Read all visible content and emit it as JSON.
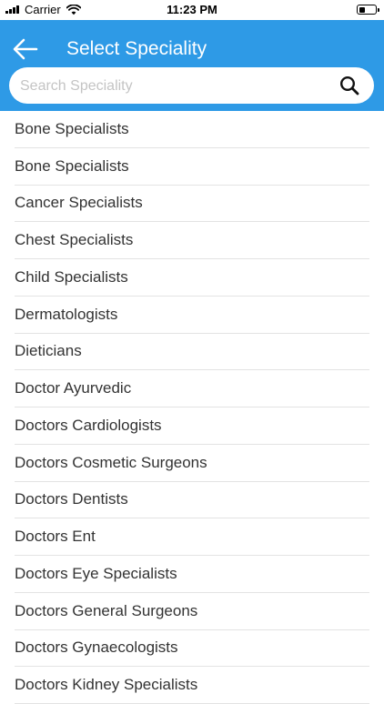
{
  "status_bar": {
    "carrier": "Carrier",
    "time": "11:23 PM"
  },
  "header": {
    "title": "Select Speciality",
    "back_icon": "arrow-left-icon",
    "background": "#2e9ae6"
  },
  "search": {
    "placeholder": "Search Speciality",
    "value": "",
    "icon": "search-icon"
  },
  "specialities": [
    {
      "label": "Bone Specialists"
    },
    {
      "label": "Bone Specialists"
    },
    {
      "label": "Cancer Specialists"
    },
    {
      "label": "Chest Specialists"
    },
    {
      "label": "Child Specialists"
    },
    {
      "label": "Dermatologists"
    },
    {
      "label": "Dieticians"
    },
    {
      "label": "Doctor Ayurvedic"
    },
    {
      "label": "Doctors Cardiologists"
    },
    {
      "label": "Doctors Cosmetic Surgeons"
    },
    {
      "label": "Doctors Dentists"
    },
    {
      "label": "Doctors Ent"
    },
    {
      "label": "Doctors Eye Specialists"
    },
    {
      "label": "Doctors General Surgeons"
    },
    {
      "label": "Doctors Gynaecologists"
    },
    {
      "label": "Doctors Kidney Specialists"
    }
  ]
}
